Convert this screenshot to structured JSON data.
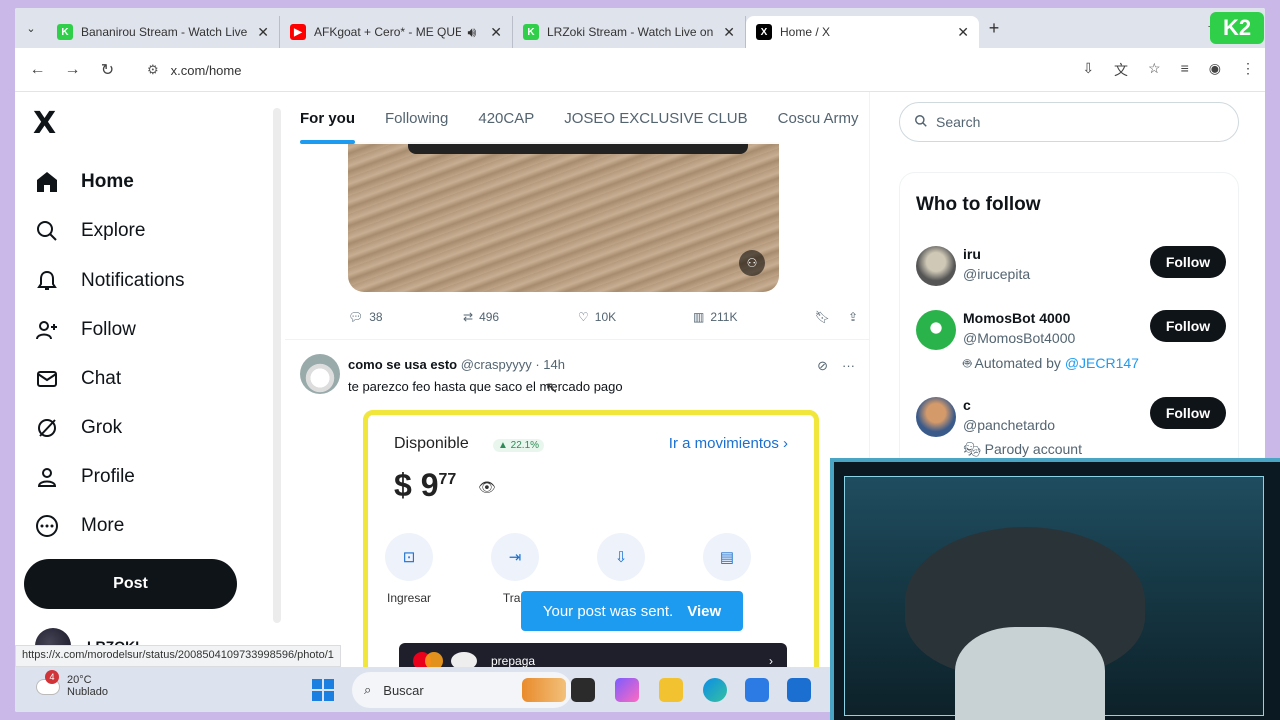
{
  "browser": {
    "tabs": [
      {
        "title": "Bananirou Stream - Watch Live",
        "fav_color": "#2fcf4a",
        "fav_letter": "K"
      },
      {
        "title": "AFKgoat + Cero* - ME QUE",
        "fav_color": "#ff0000",
        "fav_letter": "▶"
      },
      {
        "title": "LRZoki Stream - Watch Live on",
        "fav_color": "#2fcf4a",
        "fav_letter": "K"
      },
      {
        "title": "Home / X",
        "fav_color": "#000000",
        "fav_letter": "X"
      }
    ],
    "url": "x.com/home",
    "status_url": "https://x.com/morodelsur/status/2008504109733998596/photo/1"
  },
  "nav": {
    "logo": "X",
    "items": [
      {
        "label": "Home",
        "icon": "home-icon"
      },
      {
        "label": "Explore",
        "icon": "search-icon"
      },
      {
        "label": "Notifications",
        "icon": "bell-icon"
      },
      {
        "label": "Follow",
        "icon": "person-add-icon"
      },
      {
        "label": "Chat",
        "icon": "mail-icon"
      },
      {
        "label": "Grok",
        "icon": "grok-icon"
      },
      {
        "label": "Profile",
        "icon": "person-icon"
      },
      {
        "label": "More",
        "icon": "more-circle-icon"
      }
    ],
    "post_label": "Post",
    "account_name": "LRZOKI"
  },
  "feed": {
    "tabs": [
      "For you",
      "Following",
      "420CAP",
      "JOSEO EXCLUSIVE CLUB",
      "Coscu Army"
    ],
    "tweet1_stats": {
      "replies": "38",
      "reposts": "496",
      "likes": "10K",
      "views": "211K"
    },
    "tweet2": {
      "name": "como se usa esto",
      "handle": "@craspyyyy",
      "time": "· 14h",
      "text": "te parezco feo hasta que saco el mercado pago"
    },
    "card": {
      "available": "Disponible",
      "pct": "▲ 22.1%",
      "link": "Ir a movimientos ›",
      "amount": "$ 9",
      "cents": "77",
      "actions": [
        "Ingresar",
        "Tran",
        "",
        "ias"
      ],
      "prepaga": "prepaga"
    },
    "toast": {
      "text": "Your post was sent.",
      "view": "View"
    }
  },
  "right": {
    "search_placeholder": "Search",
    "wtf_title": "Who to follow",
    "users": [
      {
        "name": "iru",
        "handle": "@irucepita",
        "extra": "",
        "follow": "Follow"
      },
      {
        "name": "MomosBot 4000",
        "handle": "@MomosBot4000",
        "extra": "Automated by",
        "extra_link": "@JECR147",
        "follow": "Follow"
      },
      {
        "name": "c",
        "handle": "@panchetardo",
        "extra": "Parody account",
        "follow": "Follow"
      }
    ]
  },
  "taskbar": {
    "temp": "20°C",
    "weather": "Nublado",
    "badge": "4",
    "search": "Buscar"
  },
  "overlay": {
    "logo": "K2"
  }
}
